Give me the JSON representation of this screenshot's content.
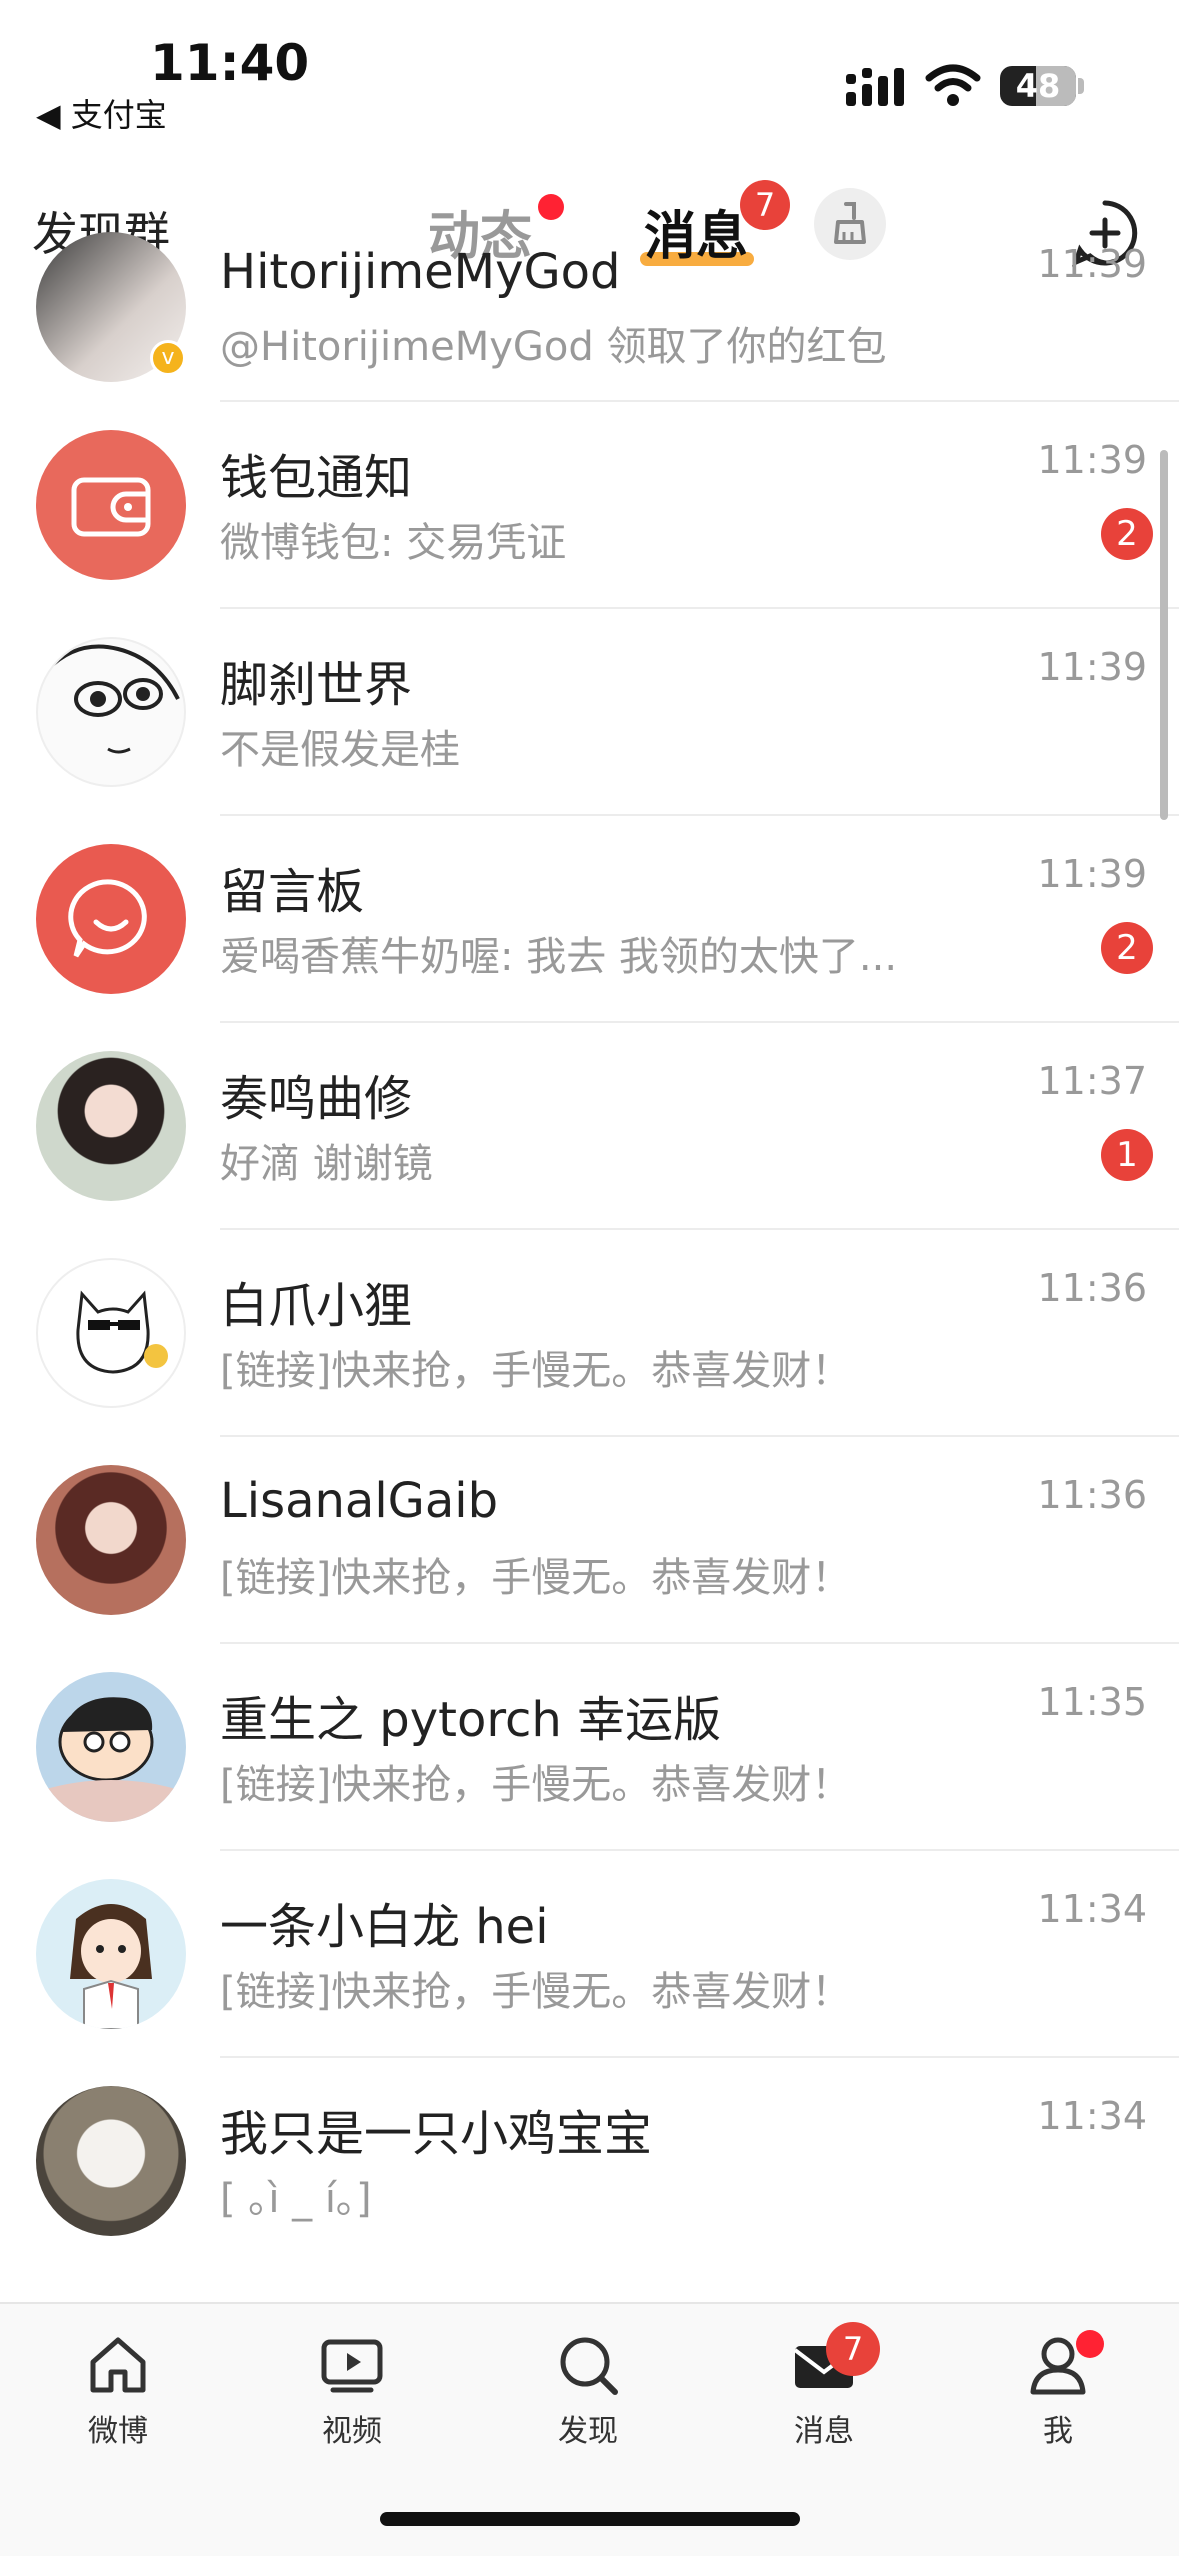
{
  "status_bar": {
    "time": "11:40",
    "back_app": "◀ 支付宝",
    "battery": "48",
    "battery_level": 0.48
  },
  "top_nav": {
    "discover_group": "发现群",
    "tab_dynamic": "动态",
    "tab_messages": "消息",
    "messages_badge": "7"
  },
  "conversations": [
    {
      "name": "HitorijimeMyGod",
      "preview": "@HitorijimeMyGod 领取了你的红包",
      "time": "11:39",
      "unread": "",
      "avatar": "photo-avatar"
    },
    {
      "name": "钱包通知",
      "preview": "微博钱包: 交易凭证",
      "time": "11:39",
      "unread": "2",
      "avatar": "wallet-icon"
    },
    {
      "name": "脚刹世界",
      "preview": "不是假发是桂",
      "time": "11:39",
      "unread": "",
      "avatar": "sketch-avatar"
    },
    {
      "name": "留言板",
      "preview": "爱喝香蕉牛奶喔: 我去 我领的太快了...",
      "time": "11:39",
      "unread": "2",
      "avatar": "chat-bubble-icon"
    },
    {
      "name": "奏鸣曲修",
      "preview": "好滴 谢谢镜",
      "time": "11:37",
      "unread": "1",
      "avatar": "photo-avatar"
    },
    {
      "name": "白爪小狸",
      "preview": "[链接]快来抢，手慢无。恭喜发财！",
      "time": "11:36",
      "unread": "",
      "avatar": "cartoon-cat-avatar"
    },
    {
      "name": "LisanalGaib",
      "preview": "[链接]快来抢，手慢无。恭喜发财！",
      "time": "11:36",
      "unread": "",
      "avatar": "photo-avatar"
    },
    {
      "name": "重生之 pytorch 幸运版",
      "preview": "[链接]快来抢，手慢无。恭喜发财！",
      "time": "11:35",
      "unread": "",
      "avatar": "cartoon-avatar"
    },
    {
      "name": "一条小白龙 hei",
      "preview": "[链接]快来抢，手慢无。恭喜发财！",
      "time": "11:34",
      "unread": "",
      "avatar": "cartoon-avatar"
    },
    {
      "name": "我只是一只小鸡宝宝",
      "preview": "[ ｡ì _ í｡]",
      "time": "11:34",
      "unread": "",
      "avatar": "bird-photo-avatar"
    }
  ],
  "tab_bar": {
    "items": [
      {
        "label": "微博",
        "icon": "home-icon"
      },
      {
        "label": "视频",
        "icon": "video-icon"
      },
      {
        "label": "发现",
        "icon": "search-icon"
      },
      {
        "label": "消息",
        "icon": "mail-icon"
      },
      {
        "label": "我",
        "icon": "person-icon"
      }
    ],
    "messages_badge": "7"
  },
  "colors": {
    "accent_red": "#e8423a",
    "tab_underline": "#f7a32b",
    "wallet_avatar": "#e8695c",
    "board_avatar": "#e95a50"
  }
}
